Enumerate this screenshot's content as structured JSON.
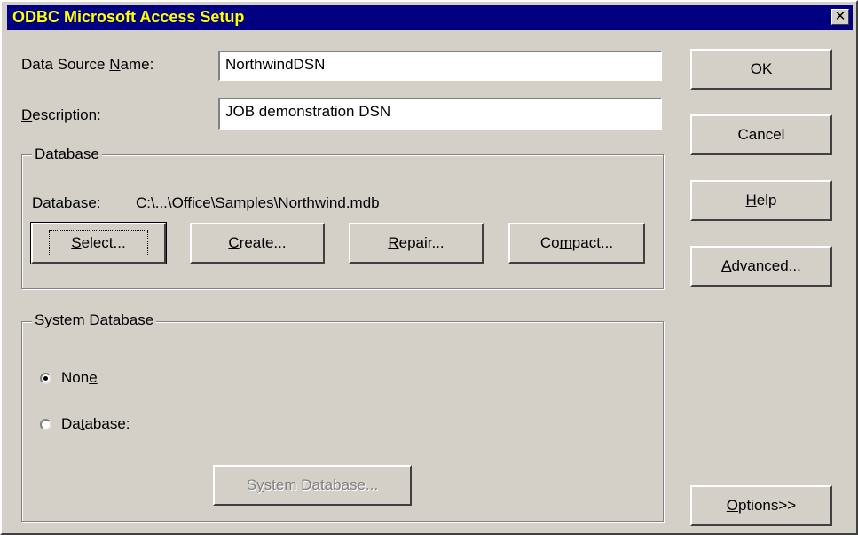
{
  "window": {
    "title": "ODBC Microsoft Access Setup",
    "close_glyph": "✕"
  },
  "fields": {
    "dsn_label_pre": "Data Source ",
    "dsn_label_key": "N",
    "dsn_label_post": "ame:",
    "dsn_value": "NorthwindDSN",
    "desc_label_pre": "",
    "desc_label_key": "D",
    "desc_label_post": "escription:",
    "desc_value": "JOB demonstration DSN"
  },
  "database_group": {
    "legend": "Database",
    "path_label": "Database:",
    "path_value": "C:\\...\\Office\\Samples\\Northwind.mdb",
    "select_pre": "",
    "select_key": "S",
    "select_post": "elect...",
    "create_pre": "",
    "create_key": "C",
    "create_post": "reate...",
    "repair_pre": "",
    "repair_key": "R",
    "repair_post": "epair...",
    "compact_pre": "Co",
    "compact_key": "m",
    "compact_post": "pact..."
  },
  "system_group": {
    "legend": "System Database",
    "none_pre": "Non",
    "none_key": "e",
    "none_post": "",
    "db_pre": "Da",
    "db_key": "t",
    "db_post": "abase:",
    "sysdb_pre": "S",
    "sysdb_key": "y",
    "sysdb_post": "stem Database...",
    "selected": "none"
  },
  "side_buttons": {
    "ok": "OK",
    "cancel": "Cancel",
    "help_pre": "",
    "help_key": "H",
    "help_post": "elp",
    "advanced_pre": "",
    "advanced_key": "A",
    "advanced_post": "dvanced...",
    "options_pre": "",
    "options_key": "O",
    "options_post": "ptions>>"
  }
}
